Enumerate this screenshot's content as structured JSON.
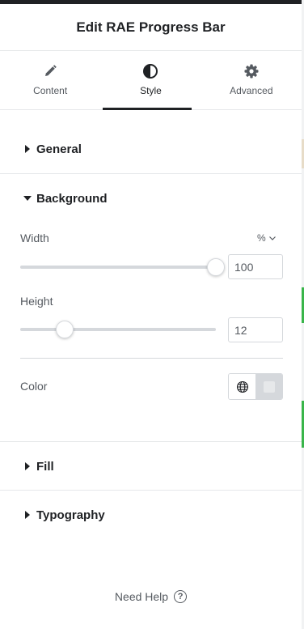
{
  "header": {
    "title": "Edit RAE Progress Bar"
  },
  "tabs": [
    {
      "label": "Content",
      "icon": "pencil-icon",
      "active": false
    },
    {
      "label": "Style",
      "icon": "contrast-icon",
      "active": true
    },
    {
      "label": "Advanced",
      "icon": "gear-icon",
      "active": false
    }
  ],
  "sections": {
    "general": {
      "label": "General",
      "expanded": false
    },
    "background": {
      "label": "Background",
      "expanded": true
    },
    "fill": {
      "label": "Fill",
      "expanded": false
    },
    "typography": {
      "label": "Typography",
      "expanded": false
    }
  },
  "background_controls": {
    "width": {
      "label": "Width",
      "unit": "%",
      "value": "100",
      "fraction": 1.0
    },
    "height": {
      "label": "Height",
      "value": "12",
      "fraction": 0.12
    },
    "color": {
      "label": "Color"
    }
  },
  "footer": {
    "help_label": "Need Help",
    "help_icon_glyph": "?"
  },
  "colors": {
    "text_primary": "#1f2124",
    "text_secondary": "#555a60",
    "border": "#d5d8dc",
    "divider": "#e6e8ea",
    "accent_green": "#39b54a"
  }
}
